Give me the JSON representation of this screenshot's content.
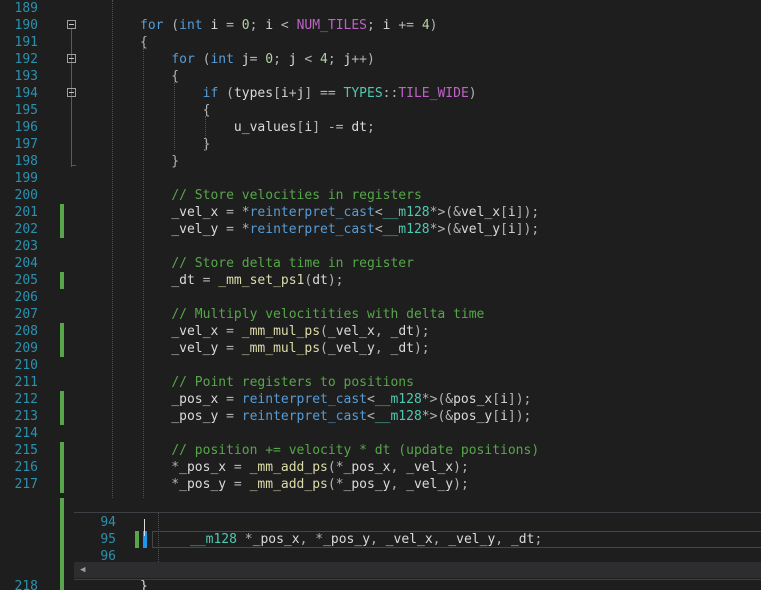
{
  "editor": {
    "lines": [
      {
        "n": "189",
        "tokens": []
      },
      {
        "n": "190",
        "tokens": [
          [
            "kw",
            "for"
          ],
          [
            "op",
            " ("
          ],
          [
            "kw",
            "int"
          ],
          [
            "vr",
            " i"
          ],
          [
            "op",
            " = "
          ],
          [
            "nm",
            "0"
          ],
          [
            "op",
            "; "
          ],
          [
            "vr",
            "i"
          ],
          [
            "op",
            " < "
          ],
          [
            "pp",
            "NUM_TILES"
          ],
          [
            "op",
            "; "
          ],
          [
            "vr",
            "i"
          ],
          [
            "op",
            " += "
          ],
          [
            "nm",
            "4"
          ],
          [
            "op",
            ")"
          ]
        ]
      },
      {
        "n": "191",
        "tokens": [
          [
            "op",
            "{"
          ]
        ]
      },
      {
        "n": "192",
        "tokens": [
          [
            "op",
            "    "
          ],
          [
            "kw",
            "for"
          ],
          [
            "op",
            " ("
          ],
          [
            "kw",
            "int"
          ],
          [
            "vr",
            " j"
          ],
          [
            "op",
            "= "
          ],
          [
            "nm",
            "0"
          ],
          [
            "op",
            "; "
          ],
          [
            "vr",
            "j"
          ],
          [
            "op",
            " < "
          ],
          [
            "nm",
            "4"
          ],
          [
            "op",
            "; "
          ],
          [
            "vr",
            "j"
          ],
          [
            "op",
            "++)"
          ]
        ]
      },
      {
        "n": "193",
        "tokens": [
          [
            "op",
            "    {"
          ]
        ]
      },
      {
        "n": "194",
        "tokens": [
          [
            "op",
            "        "
          ],
          [
            "kw",
            "if"
          ],
          [
            "op",
            " ("
          ],
          [
            "vr",
            "types"
          ],
          [
            "op",
            "["
          ],
          [
            "vr",
            "i"
          ],
          [
            "op",
            "+"
          ],
          [
            "vr",
            "j"
          ],
          [
            "op",
            "] == "
          ],
          [
            "ty",
            "TYPES"
          ],
          [
            "op",
            "::"
          ],
          [
            "pp",
            "TILE_WIDE"
          ],
          [
            "op",
            ")"
          ]
        ]
      },
      {
        "n": "195",
        "tokens": [
          [
            "op",
            "        {"
          ]
        ]
      },
      {
        "n": "196",
        "tokens": [
          [
            "op",
            "            "
          ],
          [
            "vr",
            "u_values"
          ],
          [
            "op",
            "["
          ],
          [
            "vr",
            "i"
          ],
          [
            "op",
            "] -= "
          ],
          [
            "vr",
            "dt"
          ],
          [
            "op",
            ";"
          ]
        ]
      },
      {
        "n": "197",
        "tokens": [
          [
            "op",
            "        }"
          ]
        ]
      },
      {
        "n": "198",
        "tokens": [
          [
            "op",
            "    }"
          ]
        ]
      },
      {
        "n": "199",
        "tokens": []
      },
      {
        "n": "200",
        "tokens": [
          [
            "op",
            "    "
          ],
          [
            "cm",
            "// Store velocities in registers"
          ]
        ]
      },
      {
        "n": "201",
        "tokens": [
          [
            "op",
            "    "
          ],
          [
            "vr",
            "_vel_x"
          ],
          [
            "op",
            " = *"
          ],
          [
            "kw",
            "reinterpret_cast"
          ],
          [
            "op",
            "<"
          ],
          [
            "ty",
            "__m128"
          ],
          [
            "op",
            "*>(&"
          ],
          [
            "vr",
            "vel_x"
          ],
          [
            "op",
            "["
          ],
          [
            "vr",
            "i"
          ],
          [
            "op",
            "]);"
          ]
        ]
      },
      {
        "n": "202",
        "tokens": [
          [
            "op",
            "    "
          ],
          [
            "vr",
            "_vel_y"
          ],
          [
            "op",
            " = *"
          ],
          [
            "kw",
            "reinterpret_cast"
          ],
          [
            "op",
            "<"
          ],
          [
            "ty",
            "__m128"
          ],
          [
            "op",
            "*>(&"
          ],
          [
            "vr",
            "vel_y"
          ],
          [
            "op",
            "["
          ],
          [
            "vr",
            "i"
          ],
          [
            "op",
            "]);"
          ]
        ]
      },
      {
        "n": "203",
        "tokens": []
      },
      {
        "n": "204",
        "tokens": [
          [
            "op",
            "    "
          ],
          [
            "cm",
            "// Store delta time in register"
          ]
        ]
      },
      {
        "n": "205",
        "tokens": [
          [
            "op",
            "    "
          ],
          [
            "vr",
            "_dt"
          ],
          [
            "op",
            " = "
          ],
          [
            "fn",
            "_mm_set_ps1"
          ],
          [
            "op",
            "("
          ],
          [
            "vr",
            "dt"
          ],
          [
            "op",
            ");"
          ]
        ]
      },
      {
        "n": "206",
        "tokens": []
      },
      {
        "n": "207",
        "tokens": [
          [
            "op",
            "    "
          ],
          [
            "cm",
            "// Multiply velocitities with delta time"
          ]
        ]
      },
      {
        "n": "208",
        "tokens": [
          [
            "op",
            "    "
          ],
          [
            "vr",
            "_vel_x"
          ],
          [
            "op",
            " = "
          ],
          [
            "fn",
            "_mm_mul_ps"
          ],
          [
            "op",
            "("
          ],
          [
            "vr",
            "_vel_x"
          ],
          [
            "op",
            ", "
          ],
          [
            "vr",
            "_dt"
          ],
          [
            "op",
            ");"
          ]
        ]
      },
      {
        "n": "209",
        "tokens": [
          [
            "op",
            "    "
          ],
          [
            "vr",
            "_vel_y"
          ],
          [
            "op",
            " = "
          ],
          [
            "fn",
            "_mm_mul_ps"
          ],
          [
            "op",
            "("
          ],
          [
            "vr",
            "_vel_y"
          ],
          [
            "op",
            ", "
          ],
          [
            "vr",
            "_dt"
          ],
          [
            "op",
            ");"
          ]
        ]
      },
      {
        "n": "210",
        "tokens": []
      },
      {
        "n": "211",
        "tokens": [
          [
            "op",
            "    "
          ],
          [
            "cm",
            "// Point registers to positions"
          ]
        ]
      },
      {
        "n": "212",
        "tokens": [
          [
            "op",
            "    "
          ],
          [
            "vr",
            "_pos_x"
          ],
          [
            "op",
            " = "
          ],
          [
            "kw",
            "reinterpret_cast"
          ],
          [
            "op",
            "<"
          ],
          [
            "ty",
            "__m128"
          ],
          [
            "op",
            "*>(&"
          ],
          [
            "vr",
            "pos_x"
          ],
          [
            "op",
            "["
          ],
          [
            "vr",
            "i"
          ],
          [
            "op",
            "]);"
          ]
        ]
      },
      {
        "n": "213",
        "tokens": [
          [
            "op",
            "    "
          ],
          [
            "vr",
            "_pos_y"
          ],
          [
            "op",
            " = "
          ],
          [
            "kw",
            "reinterpret_cast"
          ],
          [
            "op",
            "<"
          ],
          [
            "ty",
            "__m128"
          ],
          [
            "op",
            "*>(&"
          ],
          [
            "vr",
            "pos_y"
          ],
          [
            "op",
            "["
          ],
          [
            "vr",
            "i"
          ],
          [
            "op",
            "]);"
          ]
        ]
      },
      {
        "n": "214",
        "tokens": []
      },
      {
        "n": "215",
        "tokens": [
          [
            "op",
            "    "
          ],
          [
            "cm",
            "// position += velocity * dt (update positions)"
          ]
        ]
      },
      {
        "n": "216",
        "tokens": [
          [
            "op",
            "    *"
          ],
          [
            "vr",
            "_pos_x"
          ],
          [
            "op",
            " = "
          ],
          [
            "fn",
            "_mm_add_ps"
          ],
          [
            "op",
            "(*"
          ],
          [
            "vr",
            "_pos_x"
          ],
          [
            "op",
            ", "
          ],
          [
            "vr",
            "_vel_x"
          ],
          [
            "op",
            ");"
          ]
        ]
      },
      {
        "n": "217",
        "tokens": [
          [
            "op",
            "    *"
          ],
          [
            "vr",
            "_pos_y"
          ],
          [
            "op",
            " = "
          ],
          [
            "fn",
            "_mm_add_ps"
          ],
          [
            "op",
            "(*"
          ],
          [
            "vr",
            "_pos_y"
          ],
          [
            "op",
            ", "
          ],
          [
            "vr",
            "_vel_y"
          ],
          [
            "op",
            ");"
          ]
        ]
      }
    ],
    "bottom_partial": {
      "n": "218",
      "code": "}"
    }
  },
  "peek": {
    "lines": [
      {
        "n": "94",
        "tokens": []
      },
      {
        "n": "95",
        "tokens": [
          [
            "ty",
            "__m128"
          ],
          [
            "op",
            " *"
          ],
          [
            "vr",
            "_pos_x"
          ],
          [
            "op",
            ", *"
          ],
          [
            "vr",
            "_pos_y"
          ],
          [
            "op",
            ", "
          ],
          [
            "vr",
            "_vel_x"
          ],
          [
            "op",
            ", "
          ],
          [
            "vr",
            "_vel_y"
          ],
          [
            "op",
            ", "
          ],
          [
            "vr",
            "_dt"
          ],
          [
            "op",
            ";"
          ]
        ]
      },
      {
        "n": "96",
        "tokens": []
      }
    ],
    "scroll_left_glyph": "◀"
  },
  "colors": {
    "background": "#1e1e1e",
    "line_number": "#2b91af",
    "keyword": "#569cd6",
    "type": "#4ec9b0",
    "function": "#dcdcaa",
    "comment": "#57a64a",
    "number": "#b5cea8",
    "macro": "#bd63c5",
    "change_bar_saved": "#57a64a",
    "change_bar_unsaved": "#1c97ea"
  },
  "icons": {
    "fold": "collapse-minus-icon",
    "scroll_left": "triangle-left-icon"
  }
}
